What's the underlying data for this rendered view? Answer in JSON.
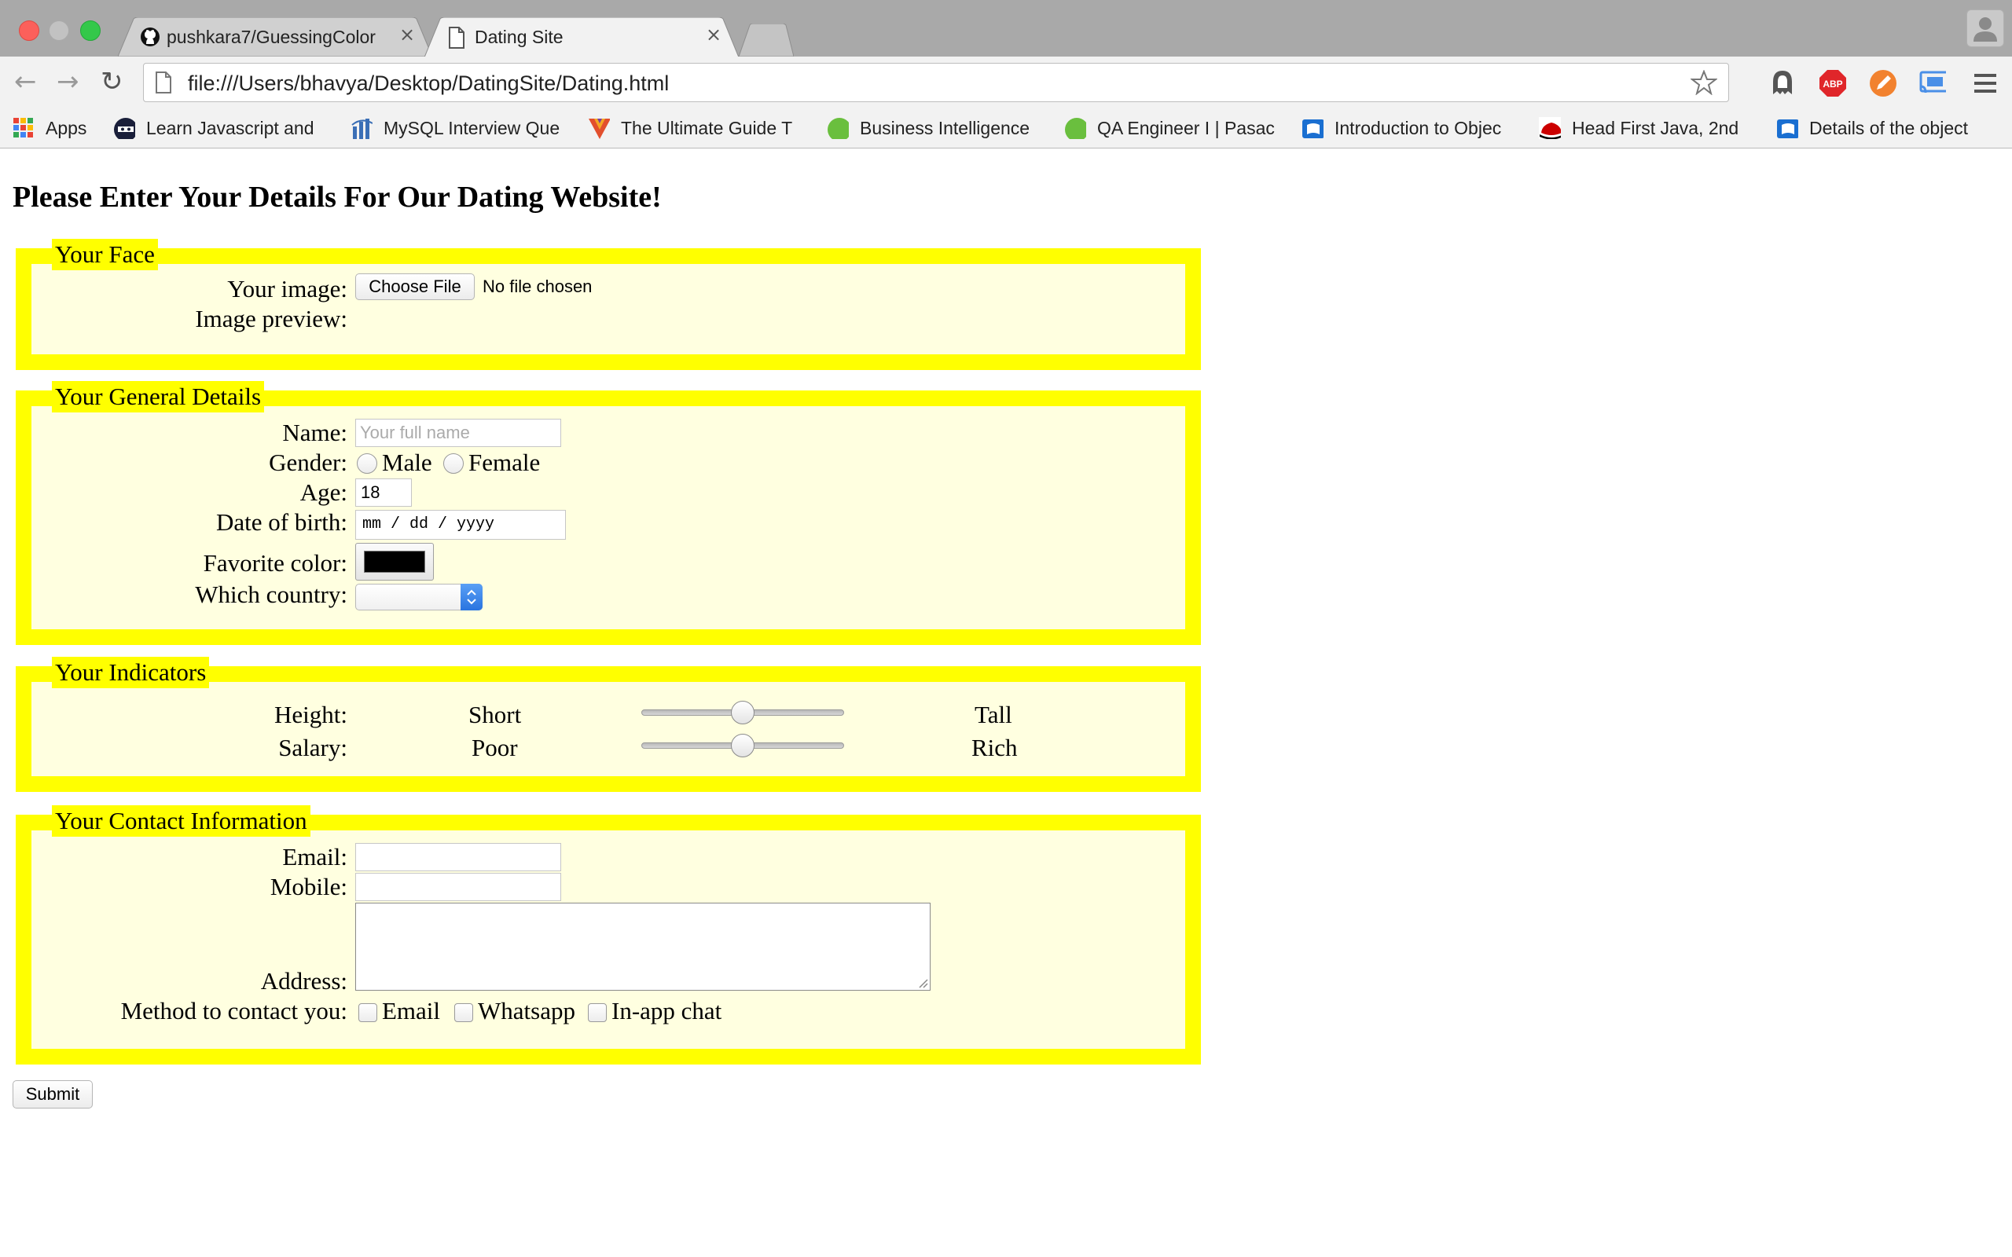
{
  "browser": {
    "tabs": [
      {
        "title": "pushkara7/GuessingColor",
        "icon": "github-icon",
        "active": false
      },
      {
        "title": "Dating Site",
        "icon": "page-icon",
        "active": true
      }
    ],
    "url": "file:///Users/bhavya/Desktop/DatingSite/Dating.html",
    "bookmarks": [
      {
        "label": "Apps",
        "icon": "apps-grid-icon"
      },
      {
        "label": "Learn Javascript and",
        "icon": "ninja-icon"
      },
      {
        "label": "MySQL Interview Que",
        "icon": "mysql-icon"
      },
      {
        "label": "The Ultimate Guide T",
        "icon": "guide-icon"
      },
      {
        "label": "Business Intelligence",
        "icon": "green-circle-icon"
      },
      {
        "label": "QA Engineer I | Pasac",
        "icon": "green-circle-icon"
      },
      {
        "label": "Introduction to Objec",
        "icon": "book-icon"
      },
      {
        "label": "Head First Java, 2nd",
        "icon": "redhat-icon"
      },
      {
        "label": "Details of the object",
        "icon": "book-icon"
      }
    ]
  },
  "page": {
    "heading": "Please Enter Your Details For Our Dating Website!",
    "face": {
      "legend": "Your Face",
      "image_label": "Your image:",
      "choose_file": "Choose File",
      "no_file": "No file chosen",
      "preview_label": "Image preview:"
    },
    "general": {
      "legend": "Your General Details",
      "name_label": "Name:",
      "name_placeholder": "Your full name",
      "gender_label": "Gender:",
      "gender_options": [
        "Male",
        "Female"
      ],
      "age_label": "Age:",
      "age_value": "18",
      "dob_label": "Date of birth:",
      "dob_placeholder": "mm / dd / yyyy",
      "color_label": "Favorite color:",
      "color_value": "#000000",
      "country_label": "Which country:"
    },
    "indicators": {
      "legend": "Your Indicators",
      "height": {
        "label": "Height:",
        "min_label": "Short",
        "max_label": "Tall",
        "value": 0.5
      },
      "salary": {
        "label": "Salary:",
        "min_label": "Poor",
        "max_label": "Rich",
        "value": 0.5
      }
    },
    "contact": {
      "legend": "Your Contact Information",
      "email_label": "Email:",
      "mobile_label": "Mobile:",
      "address_label": "Address:",
      "method_label": "Method to contact you:",
      "methods": [
        "Email",
        "Whatsapp",
        "In-app chat"
      ]
    },
    "submit": "Submit",
    "colors": {
      "fieldset_border": "#ffff00",
      "fieldset_bg": "#ffffe0"
    }
  }
}
